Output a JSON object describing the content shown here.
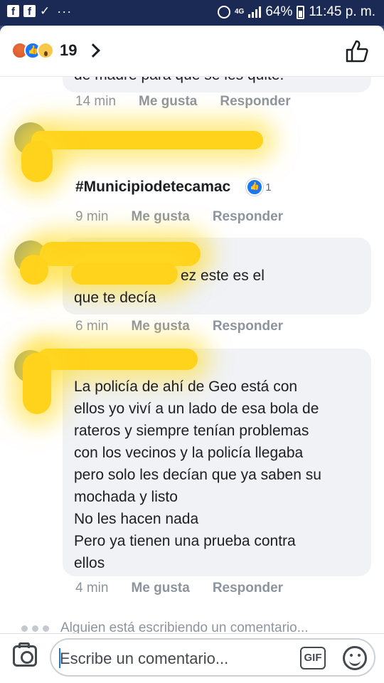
{
  "status_bar": {
    "network": "4G",
    "battery": "64%",
    "time": "11:45 p. m."
  },
  "header": {
    "reaction_count": "19"
  },
  "comments": [
    {
      "text": "de madre para que se les quite.",
      "time": "14 min",
      "like": "Me gusta",
      "reply": "Responder"
    },
    {
      "text": "#Municipiodetecamac",
      "reaction_count": "1",
      "time": "9 min",
      "like": "Me gusta",
      "reply": "Responder"
    },
    {
      "text": "ez este es el que te decía",
      "time": "6 min",
      "like": "Me gusta",
      "reply": "Responder"
    },
    {
      "lines": [
        "La policía de ahí de Geo está con",
        "ellos yo viví a un lado de esa bola de",
        "rateros y siempre tenían problemas",
        "con los vecinos y la policía llegaba",
        "pero solo les decían que ya saben su",
        "mochada y listo",
        "No les hacen nada",
        "Pero ya tienen una prueba contra",
        "ellos"
      ],
      "time": "4 min",
      "like": "Me gusta",
      "reply": "Responder"
    }
  ],
  "typing_indicator": "Alguien está escribiendo un comentario...",
  "composer": {
    "placeholder": "Escribe un comentario...",
    "gif_label": "GIF"
  }
}
